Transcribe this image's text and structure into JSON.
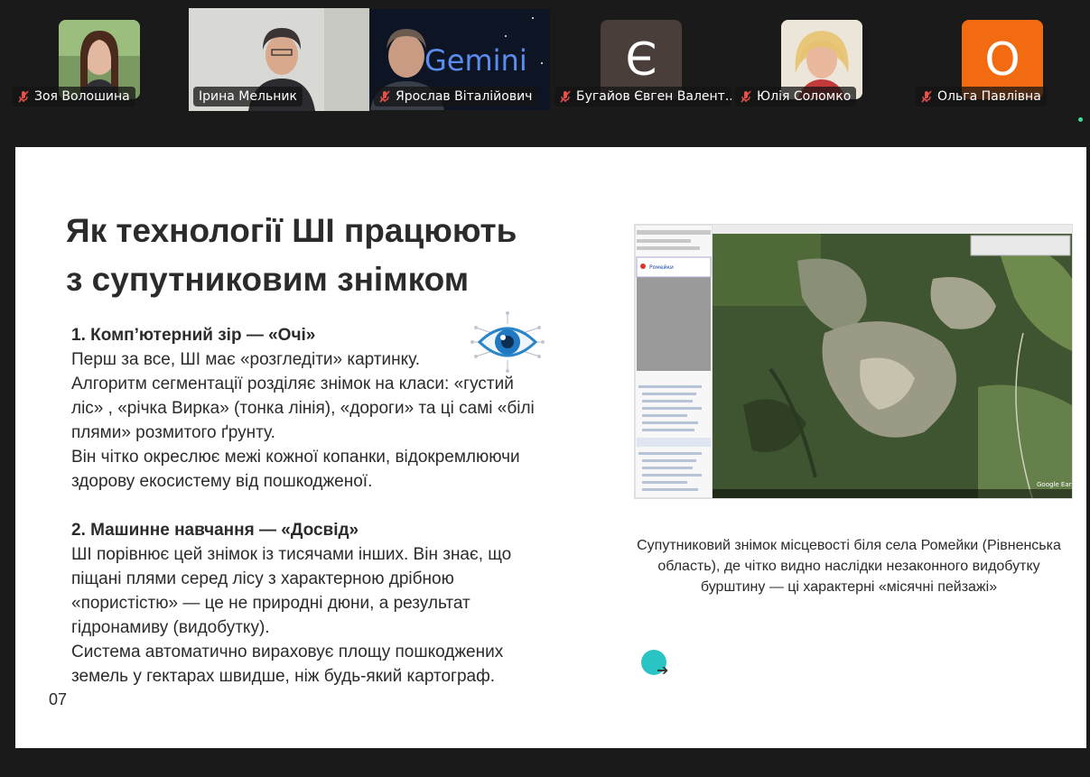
{
  "participants": [
    {
      "name": "Зоя Волошина",
      "muted": true,
      "kind": "video"
    },
    {
      "name": "Ірина Мельник",
      "muted": false,
      "kind": "video",
      "active": true
    },
    {
      "name": "Ярослав Віталійович",
      "muted": true,
      "kind": "video",
      "bg_text": "Gemini"
    },
    {
      "name": "Бугайов Євген Валент...",
      "muted": true,
      "kind": "letter",
      "letter": "Є",
      "color": "#4a3e3a"
    },
    {
      "name": "Юлія Соломко",
      "muted": true,
      "kind": "video"
    },
    {
      "name": "Ольга Павлівна",
      "muted": true,
      "kind": "letter",
      "letter": "О",
      "color": "#f26b11"
    }
  ],
  "slide": {
    "title_line1": "Як технології ШІ працюють",
    "title_line2": "з супутниковим знімком",
    "section1_heading": "1. Комп’ютерний зір — «Очі»",
    "section1_lines": [
      "Перш за все, ШІ має «розгледіти» картинку.",
      "Алгоритм сегментації розділяє знімок на класи: «густий",
      "ліс» , «річка Вирка» (тонка лінія), «дороги» та ці самі «білі",
      "плями» розмитого ґрунту.",
      "Він чітко окреслює межі кожної копанки, відокремлюючи",
      "здорову екосистему від пошкодженої."
    ],
    "section2_heading": "2. Машинне навчання — «Досвід»",
    "section2_lines": [
      "ШІ порівнює цей знімок із тисячами інших. Він знає, що",
      "піщані плями серед лісу з характерною дрібною",
      "«пористістю» — це не природні дюни, а результат",
      "гідронамиву (видобутку).",
      "Система автоматично вираховує площу пошкоджених",
      "земель у гектарах швидше, ніж будь-який картограф."
    ],
    "page_number": "07",
    "caption": "Супутниковий знімок місцевості біля села Ромейки (Рівненська область), де чітко видно наслідки незаконного видобутку бурштину — ці характерні «місячні пейзажі»",
    "map_sidebar_item": "Ромейки",
    "map_watermark": "Google Earth"
  }
}
